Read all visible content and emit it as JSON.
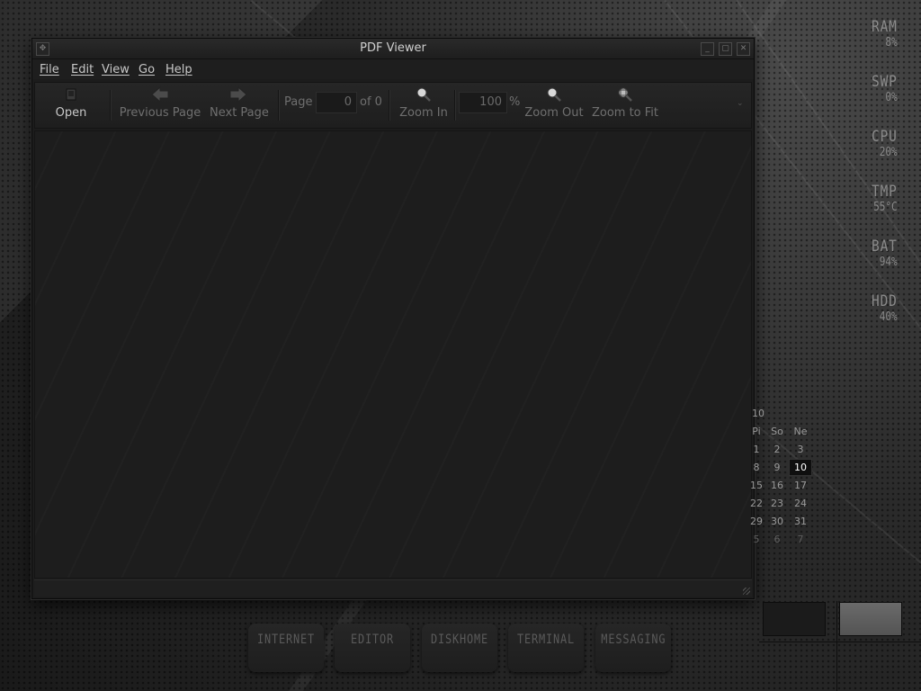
{
  "window": {
    "title": "PDF Viewer",
    "menu": [
      {
        "label": "File"
      },
      {
        "label": "Edit"
      },
      {
        "label": "View"
      },
      {
        "label": "Go"
      },
      {
        "label": "Help"
      }
    ],
    "toolbar": {
      "open": "Open",
      "previous_page": "Previous Page",
      "next_page": "Next Page",
      "page_label": "Page",
      "page_value": "0",
      "page_of": "of 0",
      "zoom_in": "Zoom In",
      "zoom_value": "100",
      "zoom_unit": "%",
      "zoom_out": "Zoom Out",
      "zoom_fit": "Zoom to Fit"
    }
  },
  "monitor": [
    {
      "key": "RAM",
      "value": "8%"
    },
    {
      "key": "SWP",
      "value": "0%"
    },
    {
      "key": "CPU",
      "value": "20%"
    },
    {
      "key": "TMP",
      "value": "55°C"
    },
    {
      "key": "BAT",
      "value": "94%"
    },
    {
      "key": "HDD",
      "value": "40%"
    }
  ],
  "calendar": {
    "header": "10",
    "weekdays": [
      "Pi",
      "So",
      "Ne"
    ],
    "rows": [
      [
        "1",
        "2",
        "3"
      ],
      [
        "8",
        "9",
        "10"
      ],
      [
        "15",
        "16",
        "17"
      ],
      [
        "22",
        "23",
        "24"
      ],
      [
        "29",
        "30",
        "31"
      ],
      [
        "5",
        "6",
        "7"
      ]
    ],
    "today": "10"
  },
  "dock": [
    {
      "label": "INTERNET"
    },
    {
      "label": "EDITOR"
    },
    {
      "label": "DISKHOME"
    },
    {
      "label": "TERMINAL"
    },
    {
      "label": "MESSAGING"
    }
  ],
  "colors": {
    "background": "#1e1e1e",
    "text_active": "#c8c8c8",
    "text_disabled": "#6f6f6f",
    "today_highlight": "#0f0f0f"
  }
}
